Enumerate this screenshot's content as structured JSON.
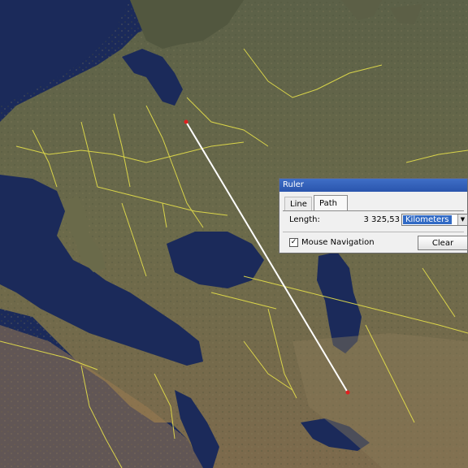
{
  "ruler": {
    "title": "Ruler",
    "tabs": [
      "Line",
      "Path"
    ],
    "active_tab": "Path",
    "length_label": "Length:",
    "length_value": "3 325,53",
    "unit_selected": "Kilometers",
    "mouse_navigation_label": "Mouse Navigation",
    "mouse_navigation_checked": true,
    "checkbox_mark": "✓",
    "clear_label": "Clear",
    "dropdown_arrow": "▼"
  },
  "map": {
    "measure_line_color": "#ffffff",
    "border_color": "#e6e04a",
    "water_color": "#1c2a5c",
    "land_color": "#6e6a48",
    "icons": [
      "map-pin-start",
      "map-pin-end"
    ]
  }
}
